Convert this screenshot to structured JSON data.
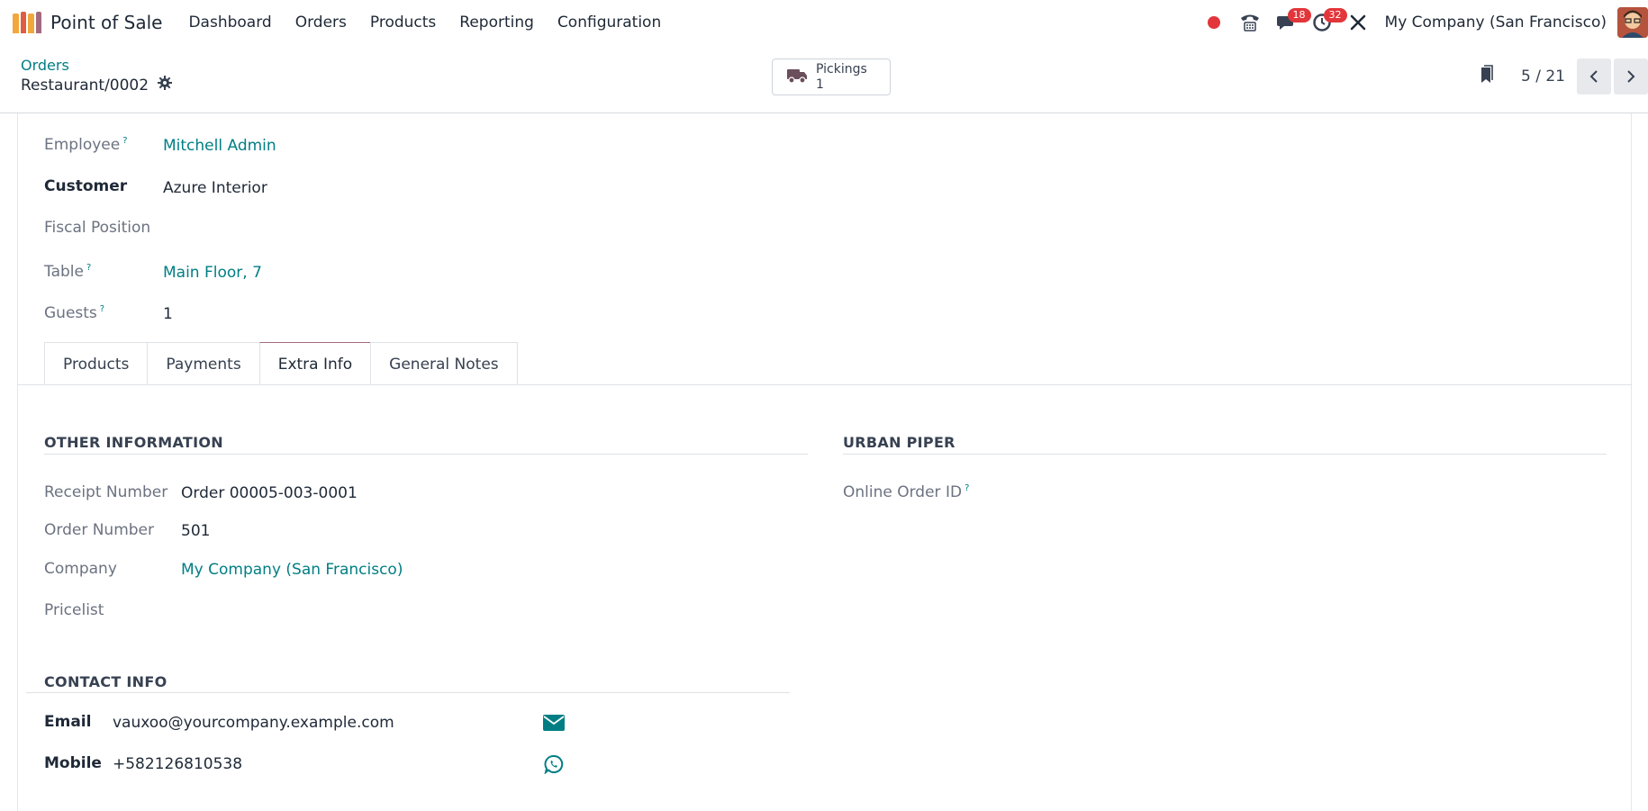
{
  "navbar": {
    "app_title": "Point of Sale",
    "menu": [
      "Dashboard",
      "Orders",
      "Products",
      "Reporting",
      "Configuration"
    ],
    "messages_count": "18",
    "activities_count": "32",
    "company": "My Company (San Francisco)",
    "icons": [
      "status-dot-icon",
      "phone-icon",
      "chat-icon",
      "clock-icon",
      "tools-icon"
    ],
    "status_color": "#e2363a"
  },
  "control_panel": {
    "breadcrumb": "Orders",
    "record": "Restaurant/0002",
    "pickings_label": "Pickings",
    "pickings_count": "1",
    "pager": "5 / 21"
  },
  "form": {
    "employee_label": "Employee",
    "employee_value": "Mitchell Admin",
    "customer_label": "Customer",
    "customer_value": "Azure Interior",
    "fiscal_label": "Fiscal Position",
    "table_label": "Table",
    "table_value": "Main Floor, 7",
    "guests_label": "Guests",
    "guests_value": "1",
    "help_mark": "?"
  },
  "tabs": [
    "Products",
    "Payments",
    "Extra Info",
    "General Notes"
  ],
  "active_tab": "Extra Info",
  "other_info": {
    "title": "OTHER INFORMATION",
    "receipt_label": "Receipt Number",
    "receipt_value": "Order 00005-003-0001",
    "order_label": "Order Number",
    "order_value": "501",
    "company_label": "Company",
    "company_value": "My Company (San Francisco)",
    "pricelist_label": "Pricelist"
  },
  "urban_piper": {
    "title": "URBAN PIPER",
    "online_label": "Online Order ID"
  },
  "contact": {
    "title": "CONTACT INFO",
    "email_label": "Email",
    "email_value": "vauxoo@yourcompany.example.com",
    "mobile_label": "Mobile",
    "mobile_value": "+582126810538"
  },
  "colors": {
    "link": "#017e84",
    "accent": "#a36a7f"
  }
}
